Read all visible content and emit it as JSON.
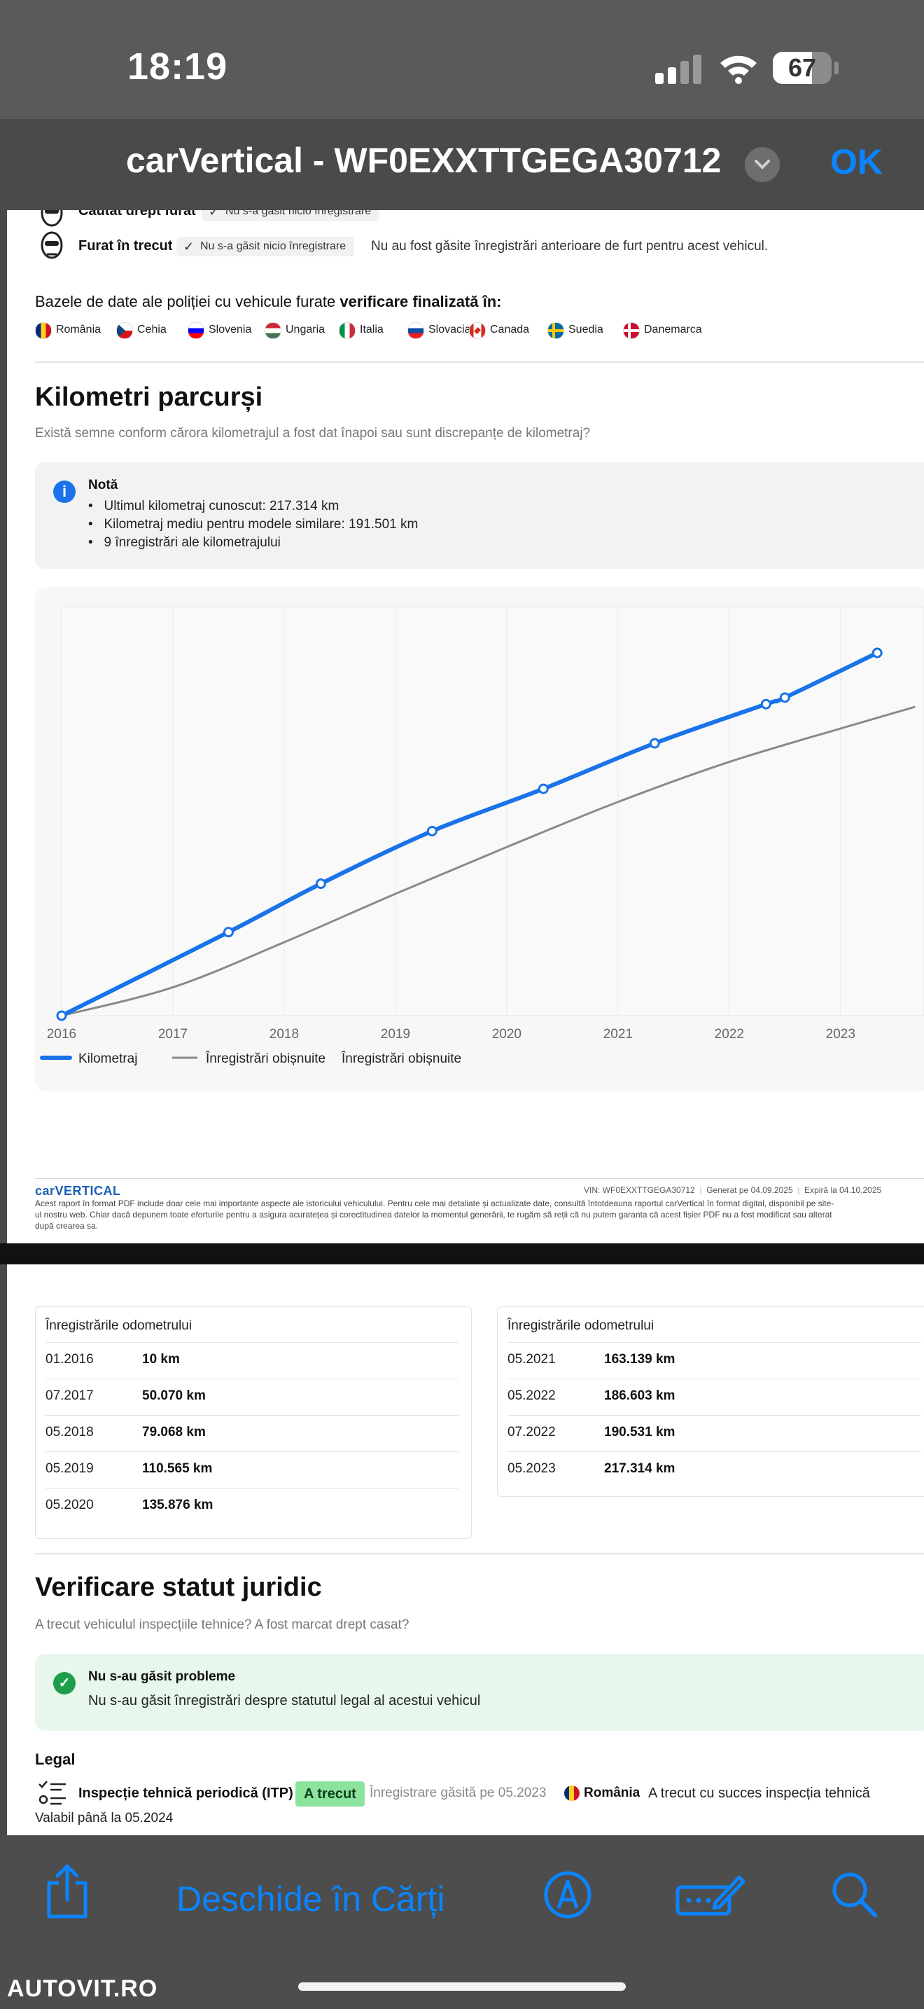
{
  "status_bar": {
    "time": "18:19",
    "battery_level": "67",
    "battery_fraction": 0.67
  },
  "viewer": {
    "title": "carVertical - WF0EXXTTGEGA30712",
    "ok_label": "OK"
  },
  "theft": {
    "row1_label": "Căutat drept furat",
    "row1_chip": "Nu s-a găsit nicio înregistrare",
    "row2_label": "Furat în trecut",
    "row2_chip": "Nu s-a găsit nicio înregistrare",
    "row2_note": "Nu au fost găsite înregistrări anterioare de furt pentru acest vehicul.",
    "db_text_plain": "Bazele de date ale poliției cu vehicule furate ",
    "db_text_bold": "verificare finalizată în:",
    "countries": [
      {
        "name": "România",
        "colors": [
          "#002b7f",
          "#fcd116",
          "#ce1126"
        ],
        "dir": "v"
      },
      {
        "name": "Cehia",
        "colors": [
          "#ffffff",
          "#d7141a",
          "#11457e"
        ],
        "dir": "cz"
      },
      {
        "name": "Slovenia",
        "colors": [
          "#ffffff",
          "#0000ff",
          "#ff0000"
        ],
        "dir": "h"
      },
      {
        "name": "Ungaria",
        "colors": [
          "#ce2939",
          "#ffffff",
          "#477050"
        ],
        "dir": "h"
      },
      {
        "name": "Italia",
        "colors": [
          "#009246",
          "#ffffff",
          "#ce2b37"
        ],
        "dir": "v"
      },
      {
        "name": "Slovacia",
        "colors": [
          "#ffffff",
          "#0b4ea2",
          "#ee1c25"
        ],
        "dir": "h"
      },
      {
        "name": "Canada",
        "colors": [
          "#d52b1e",
          "#ffffff",
          "#d52b1e"
        ],
        "dir": "ca"
      },
      {
        "name": "Suedia",
        "colors": [
          "#006aa7",
          "#fecc00"
        ],
        "dir": "cross"
      },
      {
        "name": "Danemarca",
        "colors": [
          "#c8102e",
          "#ffffff"
        ],
        "dir": "cross"
      }
    ]
  },
  "mileage": {
    "title": "Kilometri parcurși",
    "subtitle": "Există semne conform cărora kilometrajul a fost dat înapoi sau sunt discrepanțe de kilometraj?",
    "note_title": "Notă",
    "note_items": [
      "Ultimul kilometraj cunoscut: 217.314 km",
      "Kilometraj mediu pentru modele similare: 191.501 km",
      "9 înregistrări ale kilometrajului"
    ]
  },
  "chart_data": {
    "type": "line",
    "x_ticks": [
      "2016",
      "2017",
      "2018",
      "2019",
      "2020",
      "2021",
      "2022",
      "2023"
    ],
    "xlim": [
      2016,
      2023.75
    ],
    "ylim": [
      0,
      245000
    ],
    "grid": true,
    "legend_position": "bottom-left",
    "series": [
      {
        "name": "Kilometraj",
        "color": "#1a73e8",
        "points": [
          [
            2016.0,
            10
          ],
          [
            2017.5,
            50070
          ],
          [
            2018.33,
            79068
          ],
          [
            2019.33,
            110565
          ],
          [
            2020.33,
            135876
          ],
          [
            2021.33,
            163139
          ],
          [
            2022.33,
            186603
          ],
          [
            2022.5,
            190531
          ],
          [
            2023.33,
            217314
          ]
        ]
      },
      {
        "name": "Înregistrări obișnuite",
        "color": "#8a8a8a",
        "points": [
          [
            2016.0,
            0
          ],
          [
            2017.0,
            17000
          ],
          [
            2018.0,
            44000
          ],
          [
            2019.0,
            73000
          ],
          [
            2020.0,
            101000
          ],
          [
            2021.0,
            128000
          ],
          [
            2022.0,
            152000
          ],
          [
            2023.0,
            172000
          ],
          [
            2023.67,
            185000
          ]
        ]
      }
    ],
    "legend_extra": "Înregistrări obișnuite"
  },
  "footer": {
    "logo": "carVERTICAL",
    "vin_label": "VIN: WF0EXXTTGEGA30712",
    "generated": "Generat pe 04.09.2025",
    "expires": "Expiră la 04.10.2025",
    "disclaimer_1": "Acest raport în format PDF include doar cele mai importante aspecte ale istoricului vehiculului. Pentru cele mai detaliate și actualizate date, consultă întotdeauna raportul carVertical în format digital, disponibil pe site-",
    "disclaimer_2": "ul nostru web. Chiar dacă depunem toate eforturile pentru a asigura acuratețea și corectitudinea datelor la momentul generării, te rugăm să reții că nu putem garanta că acest fișier PDF nu a fost modificat sau alterat",
    "disclaimer_3": "după crearea sa."
  },
  "odometer": {
    "left_title": "Înregistrările odometrului",
    "right_title": "Înregistrările odometrului",
    "left": [
      {
        "date": "01.2016",
        "value": "10 km"
      },
      {
        "date": "07.2017",
        "value": "50.070 km"
      },
      {
        "date": "05.2018",
        "value": "79.068 km"
      },
      {
        "date": "05.2019",
        "value": "110.565 km"
      },
      {
        "date": "05.2020",
        "value": "135.876 km"
      }
    ],
    "right": [
      {
        "date": "05.2021",
        "value": "163.139 km"
      },
      {
        "date": "05.2022",
        "value": "186.603 km"
      },
      {
        "date": "07.2022",
        "value": "190.531 km"
      },
      {
        "date": "05.2023",
        "value": "217.314 km"
      }
    ]
  },
  "legal": {
    "title": "Verificare statut juridic",
    "subtitle": "A trecut vehiculul inspecțiile tehnice? A fost marcat drept casat?",
    "ok_title": "Nu s-au găsit probleme",
    "ok_text": "Nu s-au găsit înregistrări despre statutul legal al acestui vehicul",
    "section_label": "Legal",
    "itp_label": "Inspecție tehnică periodică (ITP)",
    "itp_badge": "A trecut",
    "itp_found": "Înregistrare găsită pe 05.2023",
    "itp_country": "România",
    "itp_result": "A trecut cu succes inspecția tehnică",
    "itp_valid": "Valabil până la 05.2024"
  },
  "toolbar": {
    "open_books": "Deschide în Cărți"
  },
  "watermark": "AUTOVIT.RO",
  "colors": {
    "accent": "#0a84ff",
    "mileage_line": "#1a73e8",
    "ok_green": "#1e9e4a"
  }
}
